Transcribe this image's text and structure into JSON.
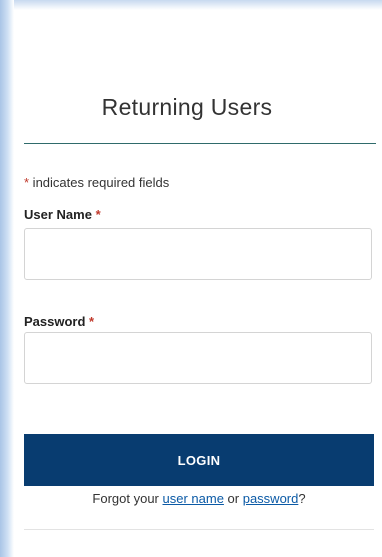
{
  "form": {
    "title": "Returning Users",
    "required_marker": "*",
    "required_note": " indicates required fields",
    "username_label": "User Name",
    "username_value": "",
    "password_label": "Password",
    "password_value": "",
    "login_label": "LOGIN",
    "forgot_prefix": "Forgot your ",
    "forgot_username_link": "user name",
    "forgot_middle": " or ",
    "forgot_password_link": "password",
    "forgot_suffix": "?"
  },
  "colors": {
    "button_bg": "#083c70",
    "divider_teal": "#2f6b6b",
    "required_red": "#c0392b",
    "link_blue": "#0b5aa6"
  }
}
